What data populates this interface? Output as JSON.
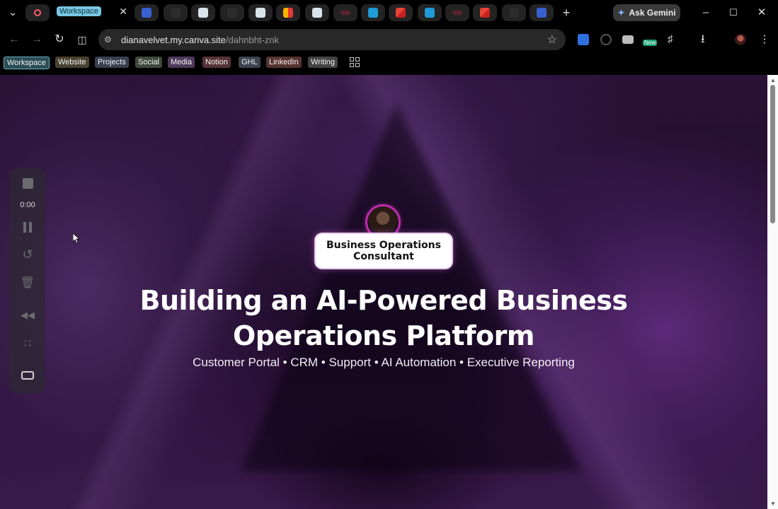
{
  "browser": {
    "active_tab_label": "Workspace",
    "gemini_label": "Ask Gemini",
    "url_host": "dianavelvet.my.canva.site",
    "url_path": "/dahnbht-znk",
    "extension_badge": "New"
  },
  "bookmarks": [
    "Workspace",
    "Website",
    "Projects",
    "Social",
    "Media",
    "Notion",
    "GHL",
    "LinkedIn",
    "Writing"
  ],
  "bookmark_colors": [
    "#2b4d55",
    "#4a4230",
    "#3a4050",
    "#3f4a3b",
    "#4d3a5c",
    "#553338",
    "#3b4350",
    "#553330",
    "#444444"
  ],
  "recorder": {
    "timer": "0:00"
  },
  "hero": {
    "badge_text": "Business Operations Consultant",
    "headline_line1": "Building an AI-Powered Business",
    "headline_line2": "Operations Platform",
    "subtitle": "Customer Portal • CRM • Support • AI Automation • Executive Reporting"
  }
}
